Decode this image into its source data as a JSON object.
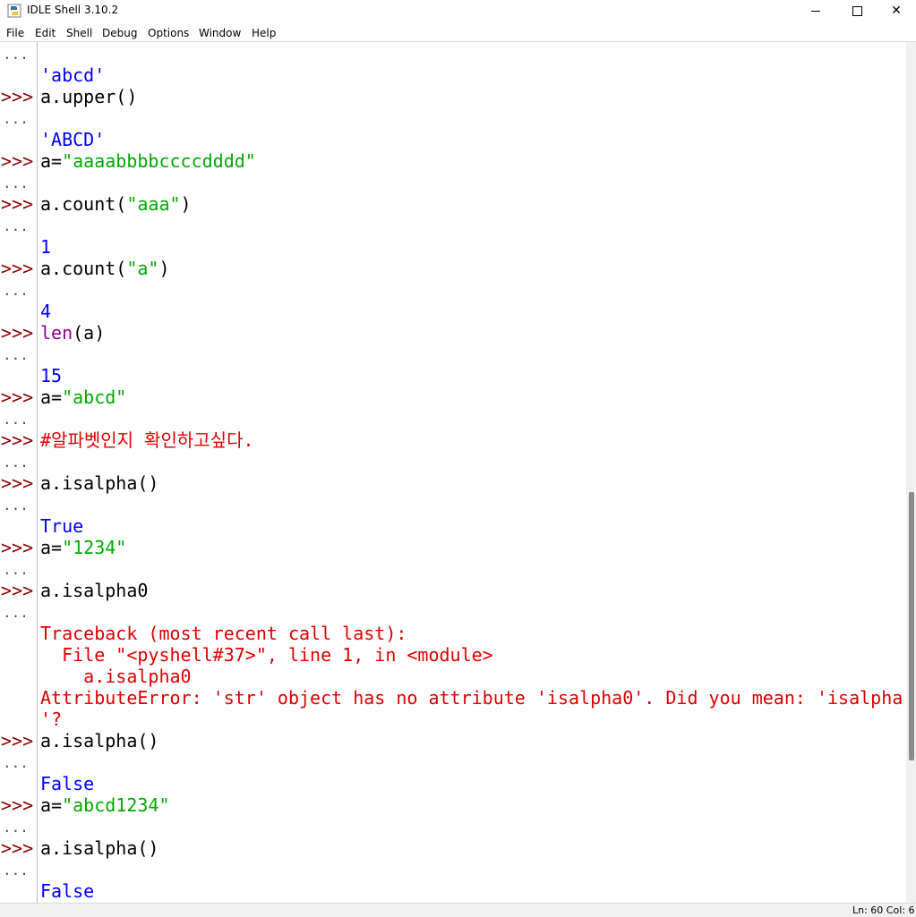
{
  "window": {
    "title": "IDLE Shell 3.10.2",
    "controls": {
      "minimize": "",
      "maximize": "",
      "close": "✕"
    }
  },
  "menu": [
    "File",
    "Edit",
    "Shell",
    "Debug",
    "Options",
    "Window",
    "Help"
  ],
  "prompts": {
    "primary": ">>>",
    "continuation": "..."
  },
  "lines": [
    {
      "segments": [
        {
          "text": "'abcd'",
          "cls": "kw-out"
        }
      ]
    },
    {
      "segments": [
        {
          "text": "a.upper()",
          "cls": "kw-txt"
        }
      ]
    },
    {
      "segments": [
        {
          "text": "'ABCD'",
          "cls": "kw-out"
        }
      ]
    },
    {
      "segments": [
        {
          "text": "a=",
          "cls": "kw-txt"
        },
        {
          "text": "\"aaaabbbbccccdddd\"",
          "cls": "kw-str"
        }
      ]
    },
    {
      "segments": [
        {
          "text": "a.count(",
          "cls": "kw-txt"
        },
        {
          "text": "\"aaa\"",
          "cls": "kw-str"
        },
        {
          "text": ")",
          "cls": "kw-txt"
        }
      ]
    },
    {
      "segments": [
        {
          "text": "1",
          "cls": "kw-out"
        }
      ]
    },
    {
      "segments": [
        {
          "text": "a.count(",
          "cls": "kw-txt"
        },
        {
          "text": "\"a\"",
          "cls": "kw-str"
        },
        {
          "text": ")",
          "cls": "kw-txt"
        }
      ]
    },
    {
      "segments": [
        {
          "text": "4",
          "cls": "kw-out"
        }
      ]
    },
    {
      "segments": [
        {
          "text": "len",
          "cls": "kw-bi"
        },
        {
          "text": "(a)",
          "cls": "kw-txt"
        }
      ]
    },
    {
      "segments": [
        {
          "text": "15",
          "cls": "kw-out"
        }
      ]
    },
    {
      "segments": [
        {
          "text": "a=",
          "cls": "kw-txt"
        },
        {
          "text": "\"abcd\"",
          "cls": "kw-str"
        }
      ]
    },
    {
      "segments": [
        {
          "text": "#알파벳인지 확인하고싶다.",
          "cls": "kw-cmt"
        }
      ]
    },
    {
      "segments": [
        {
          "text": "a.isalpha()",
          "cls": "kw-txt"
        }
      ]
    },
    {
      "segments": [
        {
          "text": "True",
          "cls": "kw-out"
        }
      ]
    },
    {
      "segments": [
        {
          "text": "a=",
          "cls": "kw-txt"
        },
        {
          "text": "\"1234\"",
          "cls": "kw-str"
        }
      ]
    },
    {
      "segments": [
        {
          "text": "a.isalpha0",
          "cls": "kw-txt"
        }
      ]
    },
    {
      "segments": [
        {
          "text": "Traceback (most recent call last):",
          "cls": "kw-err"
        }
      ]
    },
    {
      "segments": [
        {
          "text": "  File \"<pyshell#37>\", line 1, in <module>",
          "cls": "kw-err"
        }
      ]
    },
    {
      "segments": [
        {
          "text": "    a.isalpha0",
          "cls": "kw-err"
        }
      ]
    },
    {
      "segments": [
        {
          "text": "AttributeError: 'str' object has no attribute 'isalpha0'. Did you mean: 'isalpha",
          "cls": "kw-err"
        }
      ]
    },
    {
      "segments": [
        {
          "text": "'?",
          "cls": "kw-err"
        }
      ]
    },
    {
      "segments": [
        {
          "text": "a.isalpha()",
          "cls": "kw-txt"
        }
      ]
    },
    {
      "segments": [
        {
          "text": "False",
          "cls": "kw-out"
        }
      ]
    },
    {
      "segments": [
        {
          "text": "a=",
          "cls": "kw-txt"
        },
        {
          "text": "\"abcd1234\"",
          "cls": "kw-str"
        }
      ]
    },
    {
      "segments": [
        {
          "text": "a.isalpha()",
          "cls": "kw-txt"
        }
      ]
    },
    {
      "segments": [
        {
          "text": "False",
          "cls": "kw-out"
        }
      ]
    }
  ],
  "status": "Ln: 60  Col: 6"
}
